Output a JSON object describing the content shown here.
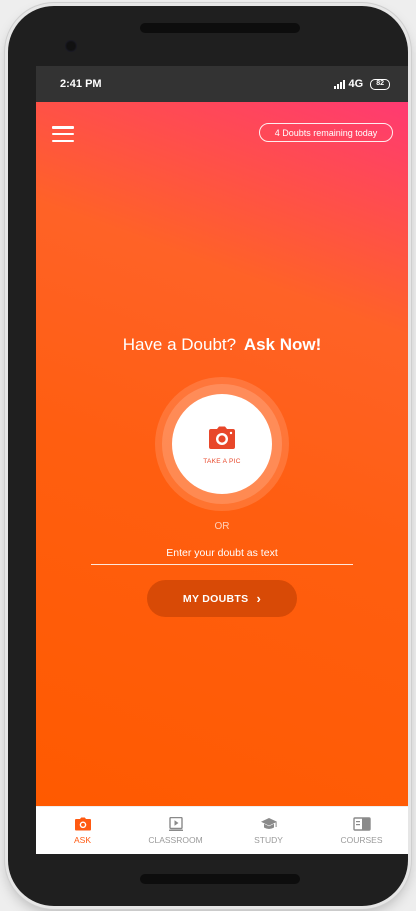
{
  "status_bar": {
    "time": "2:41 PM",
    "network": "4G",
    "battery": "82"
  },
  "header": {
    "menu_icon": "hamburger-menu-icon",
    "doubts_remaining": "4 Doubts remaining today"
  },
  "hero": {
    "headline_prefix": "Have a Doubt?",
    "headline_emphasis": "Ask Now!"
  },
  "camera": {
    "icon": "camera-icon",
    "label": "TAKE A PIC"
  },
  "or_text": "OR",
  "doubt_input": {
    "placeholder": "Enter your doubt as text",
    "value": ""
  },
  "my_doubts": {
    "label": "MY DOUBTS",
    "chevron": "›"
  },
  "bottom_nav": {
    "items": [
      {
        "label": "ASK",
        "icon": "camera-icon",
        "active": true
      },
      {
        "label": "CLASSROOM",
        "icon": "video-play-icon",
        "active": false
      },
      {
        "label": "STUDY",
        "icon": "graduation-cap-icon",
        "active": false
      },
      {
        "label": "COURSES",
        "icon": "book-icon",
        "active": false
      }
    ]
  },
  "colors": {
    "accent": "#ff5a12",
    "gradient_top": "#ff3a72",
    "button_dark": "#d84a06",
    "status_bar": "#333333"
  }
}
